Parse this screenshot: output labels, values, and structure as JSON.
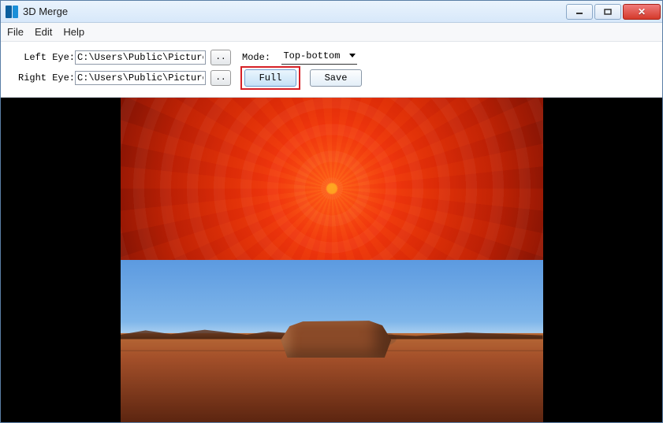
{
  "window": {
    "title": "3D Merge"
  },
  "menu": {
    "file": "File",
    "edit": "Edit",
    "help": "Help"
  },
  "toolbar": {
    "left_eye_label": " Left Eye:",
    "right_eye_label": "Right Eye:",
    "left_eye_path": "C:\\Users\\Public\\Pictures\\Sa",
    "right_eye_path": "C:\\Users\\Public\\Pictures\\Sa",
    "browse_label": "..",
    "mode_label": "Mode:",
    "mode_value": "Top-bottom",
    "full_label": "Full",
    "save_label": "Save"
  }
}
